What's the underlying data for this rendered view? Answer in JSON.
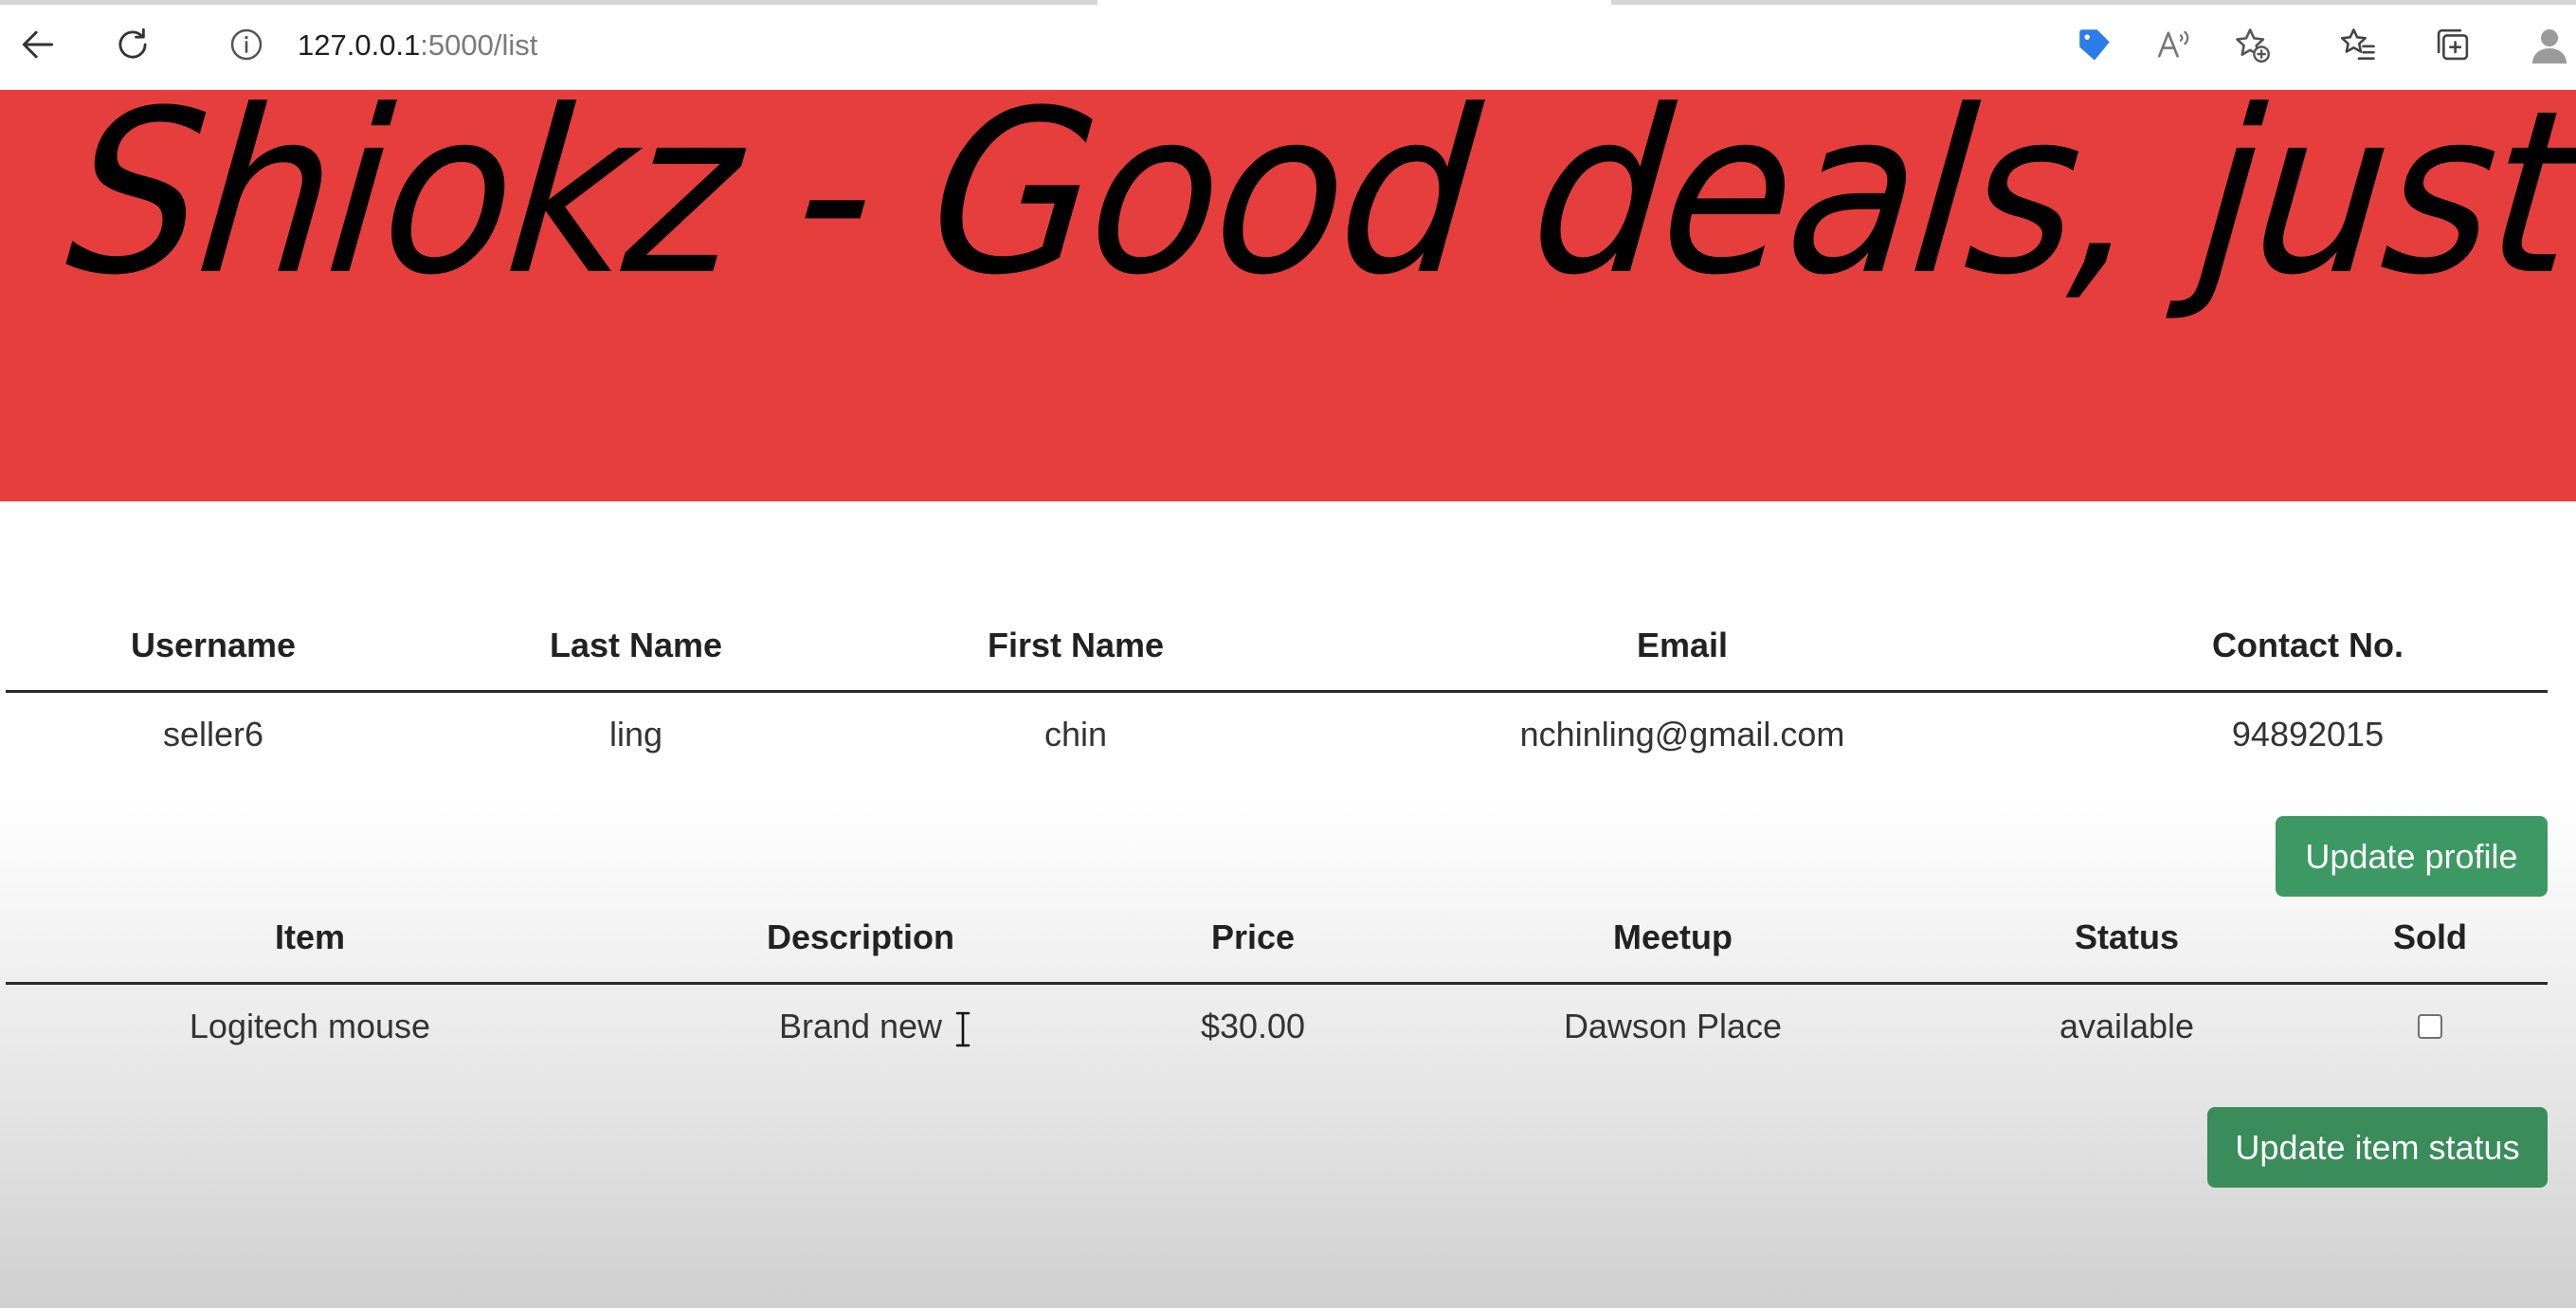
{
  "browser": {
    "url_host": "127.0.0.1",
    "url_path": ":5000/list",
    "icons": {
      "back": "back-arrow-icon",
      "refresh": "refresh-icon",
      "site_info": "info-icon",
      "shopping": "shopping-tag-icon",
      "read_aloud": "read-aloud-icon",
      "add_favorite": "add-favorite-icon",
      "favorites": "favorites-icon",
      "collections": "collections-icon",
      "profile": "profile-icon"
    },
    "accent_color": "#2b7de9"
  },
  "banner": {
    "text": "Shiokz - Good deals, just for you",
    "background_color": "#e63e3d"
  },
  "user_table": {
    "headers": [
      "Username",
      "Last Name",
      "First Name",
      "Email",
      "Contact No."
    ],
    "rows": [
      [
        "seller6",
        "ling",
        "chin",
        "nchinling@gmail.com",
        "94892015"
      ]
    ]
  },
  "update_profile_button": {
    "label": "Update profile",
    "color": "#3d9963"
  },
  "item_table": {
    "headers": [
      "Item",
      "Description",
      "Price",
      "Meetup",
      "Status",
      "Sold"
    ],
    "rows": [
      {
        "item": "Logitech mouse",
        "description": "Brand new",
        "price": "$30.00",
        "meetup": "Dawson Place",
        "status": "available",
        "sold": false
      }
    ]
  },
  "update_item_button": {
    "label": "Update item status",
    "color": "#3a8c5a"
  }
}
